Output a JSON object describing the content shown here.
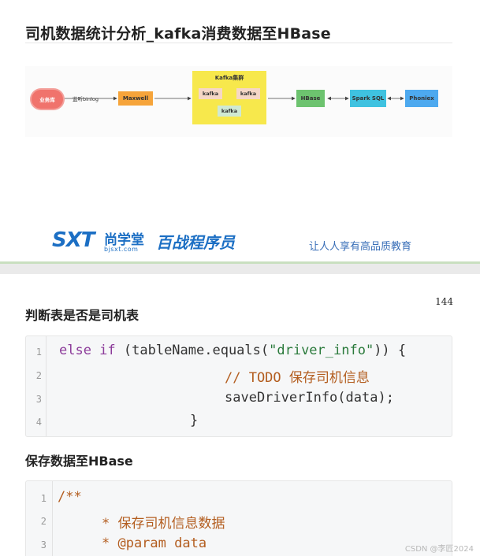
{
  "slide": {
    "title": "司机数据统计分析_kafka消费数据至HBase",
    "diagram": {
      "source": "业务库",
      "edge_label": "监听binlog",
      "maxwell": "Maxwell",
      "kafka_cluster": "Kafka集群",
      "kafka_nodes": [
        "kafka",
        "kafka",
        "kafka"
      ],
      "hbase": "HBase",
      "spark": "Spark SQL",
      "phoniex": "Phoniex"
    },
    "brand": {
      "logo": "SXT",
      "name_cn": "尚学堂",
      "url": "bjsxt.com",
      "program": "百战程序员",
      "slogan": "让人人享有高品质教育"
    }
  },
  "article": {
    "page_number": "144",
    "heading1": "判断表是否是司机表",
    "code1": {
      "line_numbers": [
        "1",
        "2",
        "3",
        "4"
      ],
      "l1_kw": "else if",
      "l1_a": " (tableName.equals(",
      "l1_str": "\"driver_info\"",
      "l1_b": ")) {",
      "l2": "// TODO 保存司机信息",
      "l3": "saveDriverInfo(data);",
      "l4": "}"
    },
    "heading2": "保存数据至HBase",
    "code2": {
      "line_numbers": [
        "1",
        "2",
        "3"
      ],
      "l1": "/**",
      "l2": "* 保存司机信息数据",
      "l3": "* @param data"
    }
  },
  "watermark": "CSDN @李匠2024"
}
